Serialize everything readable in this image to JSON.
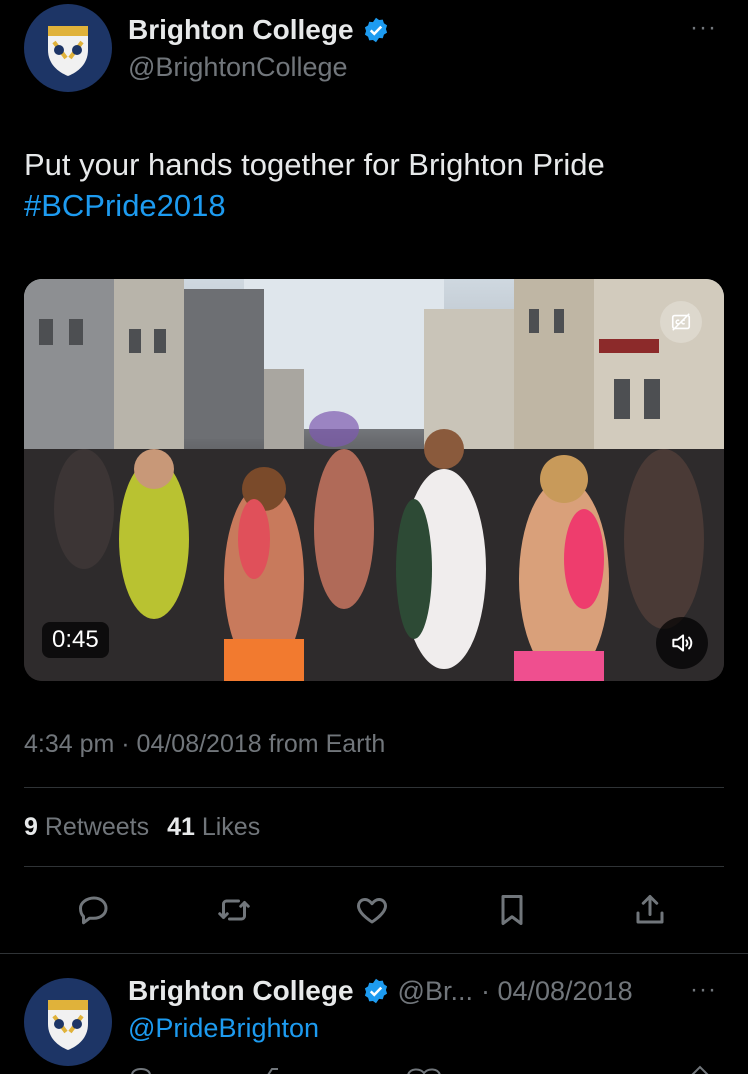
{
  "tweet": {
    "author": {
      "display_name": "Brighton College",
      "handle": "@BrightonCollege"
    },
    "more_label": "···",
    "text": "Put your hands together for Brighton Pride",
    "hashtag": "#BCPride2018",
    "video": {
      "duration": "0:45"
    },
    "meta": "4:34 pm · 04/08/2018 from Earth",
    "stats": {
      "retweets_count": "9",
      "retweets_label": "Retweets",
      "likes_count": "41",
      "likes_label": "Likes"
    },
    "actions": [
      "reply-icon",
      "retweet-icon",
      "like-icon",
      "bookmark-icon",
      "share-icon"
    ]
  },
  "reply": {
    "author": {
      "display_name": "Brighton College",
      "handle_truncated": "@Br...",
      "date": "· 04/08/2018"
    },
    "more_label": "···",
    "replying_to": "@PrideBrighton"
  },
  "colors": {
    "background": "#000000",
    "text": "#e7e9ea",
    "muted": "#71767b",
    "accent": "#1d9bf0",
    "divider": "#2f3336",
    "avatar": "#1d3566"
  }
}
